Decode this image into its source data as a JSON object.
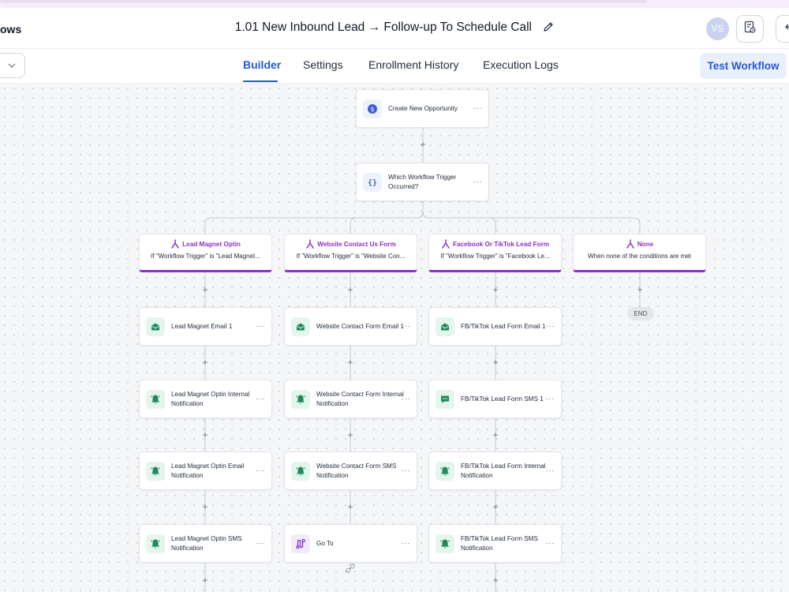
{
  "header": {
    "breadcrumb": "ows",
    "title": "1.01 New Inbound Lead → Follow-up To Schedule Call",
    "avatar": "VS"
  },
  "tabs": [
    {
      "label": "Builder",
      "active": true
    },
    {
      "label": "Settings"
    },
    {
      "label": "Enrollment History"
    },
    {
      "label": "Execution Logs"
    }
  ],
  "test_button": "Test Workflow",
  "canvas": {
    "top_nodes": [
      {
        "label": "Create New Opportunity",
        "icon": "dollar-icon"
      },
      {
        "label": "Which Workflow Trigger Occurred?",
        "icon": "braces-icon"
      }
    ],
    "branches": [
      {
        "title": "Lead Magnet Optin",
        "desc": "If \"Workflow Trigger\" is \"Lead Magnet...",
        "steps": [
          {
            "label": "Lead Magnet Email 1",
            "icon": "email-icon"
          },
          {
            "label": "Lead Magnet Optin Internal Notification",
            "icon": "bell-icon"
          },
          {
            "label": "Lead Magnet Optin Email Notification",
            "icon": "bell-icon"
          },
          {
            "label": "Lead Magnet Optin SMS Notification",
            "icon": "bell-icon"
          }
        ]
      },
      {
        "title": "Website Contact Us Form",
        "desc": "If \"Workflow Trigger\" is \"Website Con...",
        "steps": [
          {
            "label": "Website Contact Form Email 1",
            "icon": "email-icon"
          },
          {
            "label": "Website Contact Form Internal Notification",
            "icon": "bell-icon"
          },
          {
            "label": "Website Contact Form SMS Notification",
            "icon": "bell-icon"
          },
          {
            "label": "Go To",
            "icon": "goto-icon"
          }
        ]
      },
      {
        "title": "Facebook Or TikTok Lead Form",
        "desc": "If \"Workflow Trigger\" is \"Facebook Le...",
        "steps": [
          {
            "label": "FB/TikTok Lead Form Email 1",
            "icon": "email-icon"
          },
          {
            "label": "FB/TikTok Lead Form SMS 1",
            "icon": "sms-icon"
          },
          {
            "label": "FB/TikTok Lead Form Internal Notification",
            "icon": "bell-icon"
          },
          {
            "label": "FB/TikTok Lead Form SMS Notification",
            "icon": "bell-icon"
          }
        ]
      },
      {
        "title": "None",
        "desc": "When none of the conditions are met",
        "steps": []
      }
    ],
    "end_label": "END",
    "more_glyph": "···",
    "plus_glyph": "+"
  },
  "colors": {
    "accent": "#2557d6",
    "branch": "#8b2fc9",
    "email_icon": "#1f8a5b",
    "bell_icon": "#1f8a5b",
    "goto_icon": "#8b2fc9",
    "dollar_icon": "#3b5bdb"
  }
}
